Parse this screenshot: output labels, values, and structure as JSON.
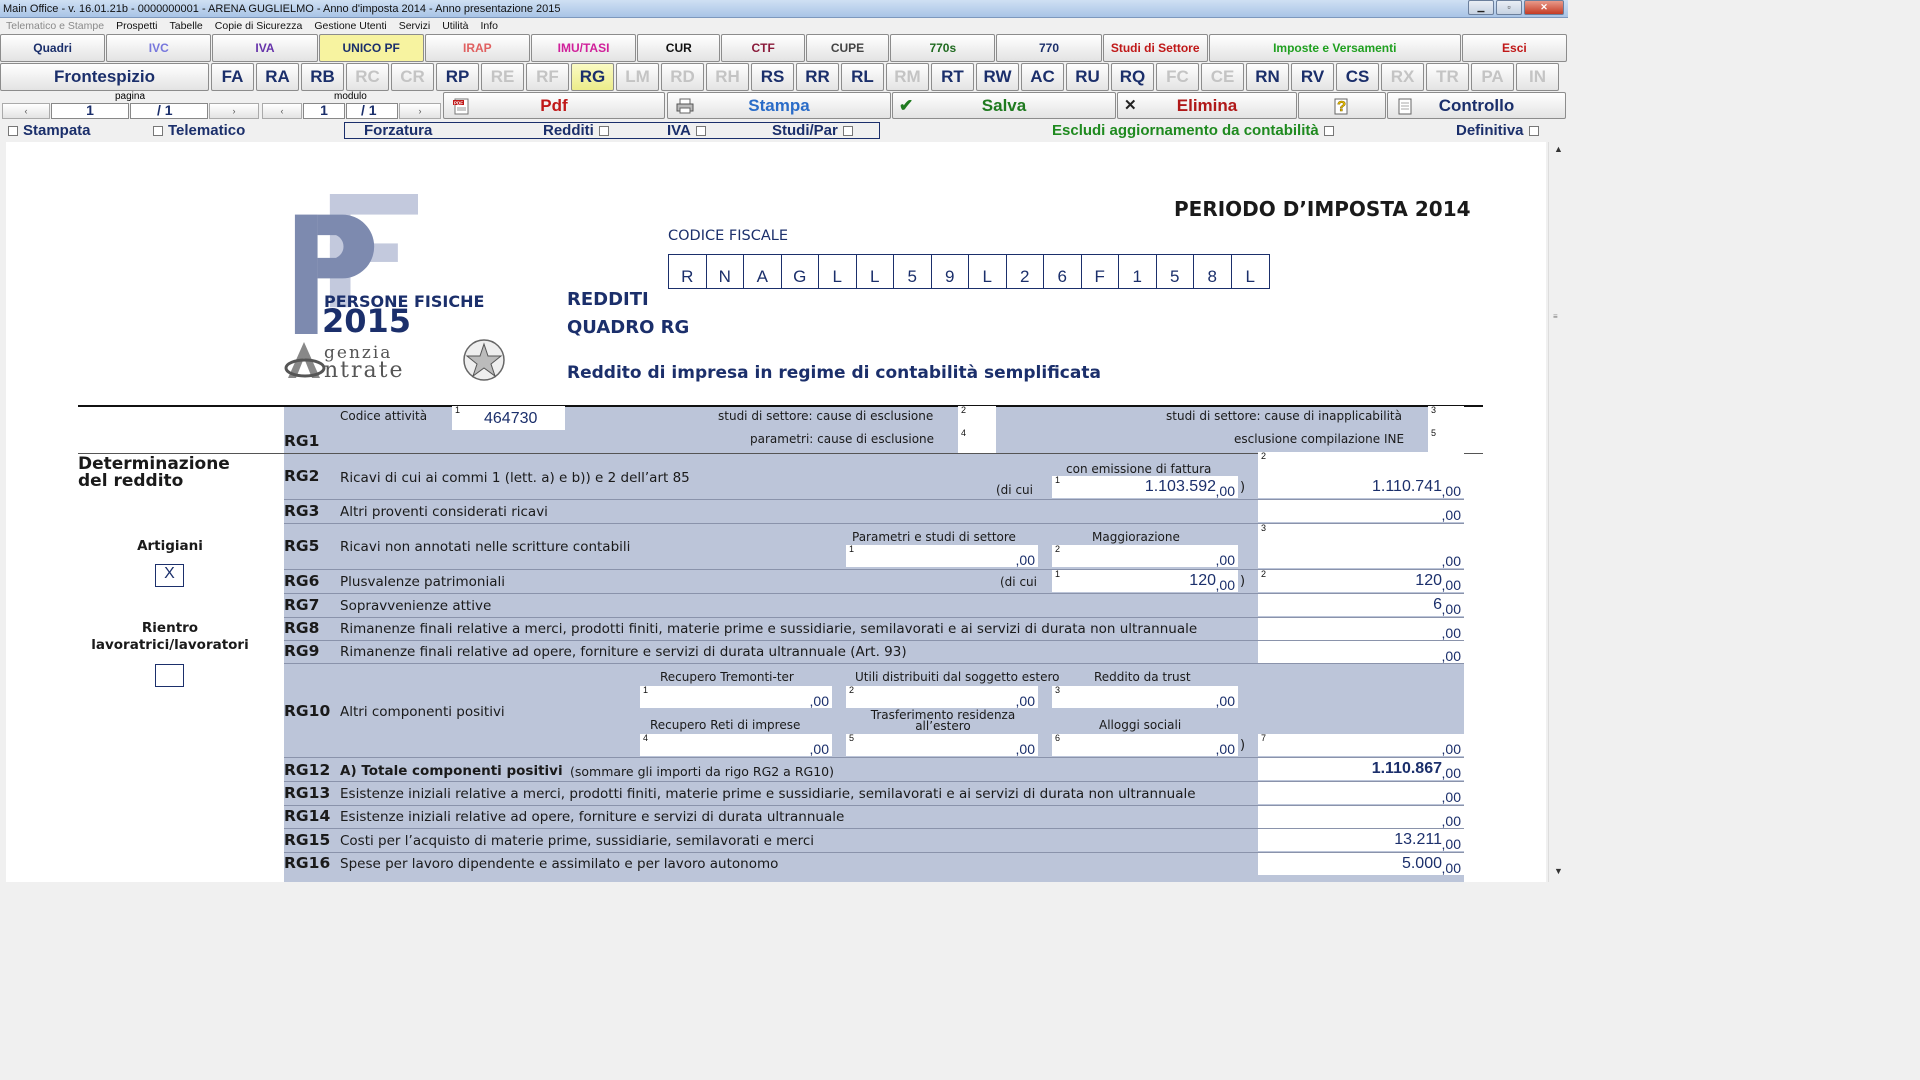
{
  "window": {
    "title": "Main Office - v. 16.01.21b - 0000000001 - ARENA GUGLIELMO - Anno d'imposta 2014 - Anno presentazione 2015"
  },
  "menu": [
    {
      "label": "Telematico e Stampe",
      "enabled": false
    },
    {
      "label": "Prospetti",
      "enabled": true
    },
    {
      "label": "Tabelle",
      "enabled": true
    },
    {
      "label": "Copie di Sicurezza",
      "enabled": true
    },
    {
      "label": "Gestione Utenti",
      "enabled": true
    },
    {
      "label": "Servizi",
      "enabled": true
    },
    {
      "label": "Utilità",
      "enabled": true
    },
    {
      "label": "Info",
      "enabled": true
    }
  ],
  "topTabs": [
    {
      "label": "Quadri",
      "color": "#1b2f6b",
      "bg": ""
    },
    {
      "label": "IVC",
      "color": "#7777dd",
      "bg": ""
    },
    {
      "label": "IVA",
      "color": "#6633aa",
      "bg": ""
    },
    {
      "label": "UNICO PF",
      "color": "#1b2f6b",
      "bg": "#f7f3a0"
    },
    {
      "label": "IRAP",
      "color": "#e06060",
      "bg": ""
    },
    {
      "label": "IMU/TASI",
      "color": "#d0209a",
      "bg": ""
    },
    {
      "label": "CUR",
      "color": "#111111",
      "bg": ""
    },
    {
      "label": "CTF",
      "color": "#8a1a3a",
      "bg": ""
    },
    {
      "label": "CUPE",
      "color": "#444444",
      "bg": ""
    },
    {
      "label": "770s",
      "color": "#1f6a1f",
      "bg": ""
    },
    {
      "label": "770",
      "color": "#1b2f6b",
      "bg": ""
    },
    {
      "label": "Studi di Settore",
      "color": "#c01818",
      "bg": ""
    },
    {
      "label": "Imposte e Versamenti",
      "color": "#20a020",
      "bg": ""
    },
    {
      "label": "Esci",
      "color": "#c01818",
      "bg": ""
    }
  ],
  "quadri": [
    {
      "label": "Frontespizio",
      "state": "normal"
    },
    {
      "label": "FA",
      "state": "normal"
    },
    {
      "label": "RA",
      "state": "normal"
    },
    {
      "label": "RB",
      "state": "normal"
    },
    {
      "label": "RC",
      "state": "disabled"
    },
    {
      "label": "CR",
      "state": "disabled"
    },
    {
      "label": "RP",
      "state": "normal"
    },
    {
      "label": "RE",
      "state": "disabled"
    },
    {
      "label": "RF",
      "state": "disabled"
    },
    {
      "label": "RG",
      "state": "selected"
    },
    {
      "label": "LM",
      "state": "disabled"
    },
    {
      "label": "RD",
      "state": "disabled"
    },
    {
      "label": "RH",
      "state": "disabled"
    },
    {
      "label": "RS",
      "state": "normal"
    },
    {
      "label": "RR",
      "state": "normal"
    },
    {
      "label": "RL",
      "state": "normal"
    },
    {
      "label": "RM",
      "state": "disabled"
    },
    {
      "label": "RT",
      "state": "normal"
    },
    {
      "label": "RW",
      "state": "normal"
    },
    {
      "label": "AC",
      "state": "normal"
    },
    {
      "label": "RU",
      "state": "normal"
    },
    {
      "label": "RQ",
      "state": "normal"
    },
    {
      "label": "FC",
      "state": "disabled"
    },
    {
      "label": "CE",
      "state": "disabled"
    },
    {
      "label": "RN",
      "state": "normal"
    },
    {
      "label": "RV",
      "state": "normal"
    },
    {
      "label": "CS",
      "state": "normal"
    },
    {
      "label": "RX",
      "state": "disabled"
    },
    {
      "label": "TR",
      "state": "disabled"
    },
    {
      "label": "PA",
      "state": "disabled"
    },
    {
      "label": "IN",
      "state": "disabled"
    }
  ],
  "nav": {
    "pagina_label": "pagina",
    "pagina_value": "1",
    "pagina_total": "/ 1",
    "modulo_label": "modulo",
    "modulo_value": "1",
    "modulo_total": "/ 1"
  },
  "actions": {
    "pdf": "Pdf",
    "stampa": "Stampa",
    "salva": "Salva",
    "elimina": "Elimina",
    "controllo": "Controllo",
    "colors": {
      "pdf": "#c01818",
      "stampa": "#2a6cc8",
      "salva": "#1f7a1f",
      "elimina": "#b01818",
      "controllo": "#1b2f6b"
    }
  },
  "flags": {
    "stampata": "Stampata",
    "telematico": "Telematico",
    "forzatura": "Forzatura",
    "redditi": "Redditi",
    "iva": "IVA",
    "studi": "Studi/Par",
    "escludi": "Escludi aggiornamento da contabilità",
    "definitiva": "Definitiva"
  },
  "form": {
    "periodo": "PERIODO D’IMPOSTA 2014",
    "codice_fiscale_label": "CODICE FISCALE",
    "codice_fiscale": [
      "R",
      "N",
      "A",
      "G",
      "L",
      "L",
      "5",
      "9",
      "L",
      "2",
      "6",
      "F",
      "1",
      "5",
      "8",
      "L"
    ],
    "logo_persone": "PERSONE FISICHE",
    "logo_year": "2015",
    "logo_agenzia": "genzia",
    "logo_entrate": "ntrate",
    "redditi": "REDDITI",
    "quadro": "QUADRO RG",
    "subtitle": "Reddito di impresa in regime di contabilità semplificata",
    "side_determinazione": "Determinazione del reddito",
    "side_artigiani": "Artigiani",
    "artigiani_mark": "X",
    "side_rientro": "Rientro lavoratrici/lavoratori"
  },
  "rg1": {
    "label": "RG1",
    "codice_attivita_label": "Codice attività",
    "codice_attivita": "464730",
    "esclusione_label": "studi di settore: cause di esclusione",
    "inapplicabilita_label": "studi di settore: cause di inapplicabilità",
    "parametri_label": "parametri: cause di esclusione",
    "ine_label": "esclusione compilazione INE"
  },
  "rows": {
    "rg2": {
      "label": "RG2",
      "text": "Ricavi di cui ai commi 1 (lett. a) e b)) e 2 dell’art 85",
      "sub_label": "con emissione di fattura",
      "dicui": "(di cui",
      "c1": "1.103.592",
      "c2": "1.110.741",
      "dec": ",00"
    },
    "rg3": {
      "label": "RG3",
      "text": "Altri proventi considerati ricavi",
      "c": "",
      "dec": ",00"
    },
    "rg5": {
      "label": "RG5",
      "text": "Ricavi non annotati nelle scritture contabili",
      "h1": "Parametri e studi di settore",
      "h2": "Maggiorazione",
      "c1": "",
      "c2": "",
      "c3": "",
      "dec": ",00"
    },
    "rg6": {
      "label": "RG6",
      "text": "Plusvalenze patrimoniali",
      "dicui": "(di cui",
      "c1": "120",
      "c2": "120",
      "dec": ",00"
    },
    "rg7": {
      "label": "RG7",
      "text": "Sopravvenienze attive",
      "c": "6",
      "dec": ",00"
    },
    "rg8": {
      "label": "RG8",
      "text": "Rimanenze finali relative a merci, prodotti finiti, materie prime e sussidiarie, semilavorati e ai servizi di durata non ultrannuale",
      "c": "",
      "dec": ",00"
    },
    "rg9": {
      "label": "RG9",
      "text": "Rimanenze finali relative ad opere, forniture e servizi di durata ultrannuale (Art. 93)",
      "c": "",
      "dec": ",00"
    },
    "rg10": {
      "label": "RG10",
      "text": "Altri componenti positivi",
      "h1": "Recupero Tremonti-ter",
      "h2": "Utili distribuiti dal soggetto estero",
      "h3": "Reddito da trust",
      "h4": "Recupero Reti di imprese",
      "h5": "Trasferimento residenza all’estero",
      "h6": "Alloggi sociali",
      "dec": ",00"
    },
    "rg12": {
      "label": "RG12",
      "text_bold": "A) Totale componenti positivi",
      "text_small": "(sommare gli importi da rigo RG2 a RG10)",
      "c": "1.110.867",
      "dec": ",00"
    },
    "rg13": {
      "label": "RG13",
      "text": "Esistenze iniziali relative a merci, prodotti finiti, materie prime e sussidiarie, semilavorati e ai servizi di durata non ultrannuale",
      "c": "",
      "dec": ",00"
    },
    "rg14": {
      "label": "RG14",
      "text": "Esistenze iniziali relative ad opere, forniture e servizi di durata ultrannuale",
      "c": "",
      "dec": ",00"
    },
    "rg15": {
      "label": "RG15",
      "text": "Costi per l’acquisto di materie prime, sussidiarie, semilavorati e merci",
      "c": "13.211",
      "dec": ",00"
    },
    "rg16": {
      "label": "RG16",
      "text": "Spese per lavoro dipendente e assimilato e per lavoro autonomo",
      "c": "5.000",
      "dec": ",00"
    }
  }
}
